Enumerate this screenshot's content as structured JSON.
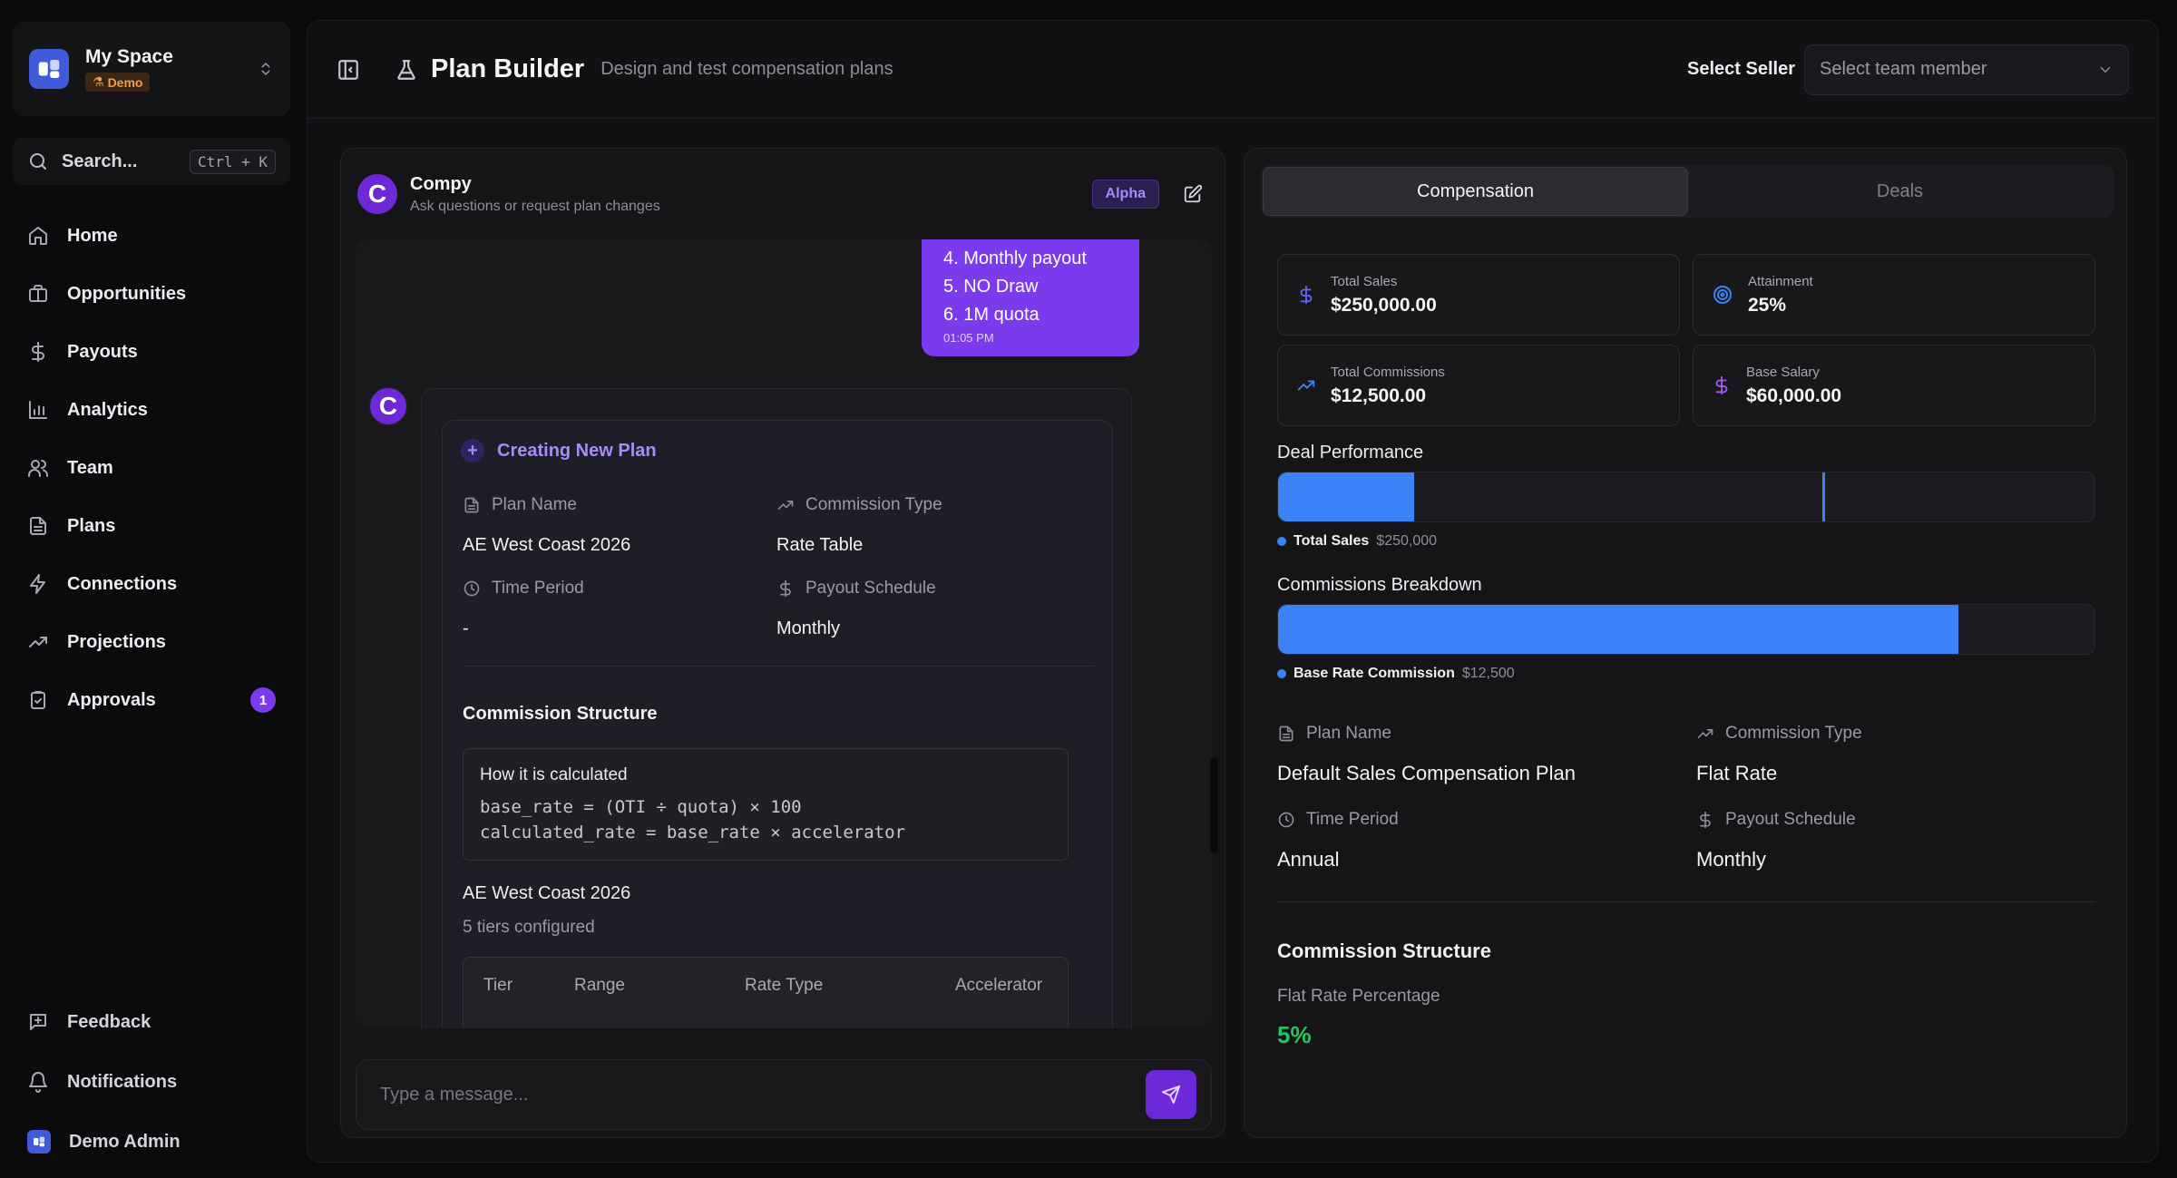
{
  "workspace": {
    "name": "My Space",
    "badge": "Demo"
  },
  "search": {
    "label": "Search...",
    "shortcut": "Ctrl + K"
  },
  "nav": {
    "items": [
      {
        "label": "Home",
        "icon": "home-icon"
      },
      {
        "label": "Opportunities",
        "icon": "briefcase-icon"
      },
      {
        "label": "Payouts",
        "icon": "dollar-icon"
      },
      {
        "label": "Analytics",
        "icon": "bar-chart-icon"
      },
      {
        "label": "Team",
        "icon": "users-icon"
      },
      {
        "label": "Plans",
        "icon": "file-text-icon"
      },
      {
        "label": "Connections",
        "icon": "zap-icon"
      },
      {
        "label": "Projections",
        "icon": "trending-up-icon"
      },
      {
        "label": "Approvals",
        "icon": "clipboard-check-icon",
        "badge": "1"
      }
    ],
    "bottom": [
      {
        "label": "Feedback",
        "icon": "message-plus-icon"
      },
      {
        "label": "Notifications",
        "icon": "bell-icon"
      },
      {
        "label": "Demo Admin",
        "icon": "avatar"
      }
    ]
  },
  "header": {
    "title": "Plan Builder",
    "subtitle": "Design and test compensation plans",
    "seller_label": "Select Seller",
    "seller_placeholder": "Select team member"
  },
  "chat": {
    "bot_name": "Compy",
    "bot_sub": "Ask questions or request plan changes",
    "bot_initial": "C",
    "badge": "Alpha",
    "user_message": {
      "lines": [
        "4. Monthly payout",
        "5. NO Draw",
        "6. 1M quota"
      ],
      "time": "01:05 PM"
    },
    "plan_card": {
      "title": "Creating New Plan",
      "plan_name_label": "Plan Name",
      "plan_name": "AE West Coast 2026",
      "commission_type_label": "Commission Type",
      "commission_type": "Rate Table",
      "time_period_label": "Time Period",
      "time_period": "-",
      "payout_schedule_label": "Payout Schedule",
      "payout_schedule": "Monthly",
      "structure_title": "Commission Structure",
      "formula_title": "How it is calculated",
      "formula_lines": [
        "base_rate = (OTI ÷ quota) × 100",
        "calculated_rate = base_rate × accelerator"
      ],
      "table_name": "AE West Coast 2026",
      "tiers_text": "5 tiers configured",
      "columns": [
        "Tier",
        "Range",
        "Rate Type",
        "Accelerator"
      ]
    },
    "composer_placeholder": "Type a message..."
  },
  "right": {
    "tabs": [
      "Compensation",
      "Deals"
    ],
    "active_tab": 0,
    "stats": [
      {
        "label": "Total Sales",
        "value": "$250,000.00",
        "icon": "dollar-icon",
        "color": "#6366f1"
      },
      {
        "label": "Attainment",
        "value": "25%",
        "icon": "target-icon",
        "color": "#3b82f6"
      },
      {
        "label": "Total Commissions",
        "value": "$12,500.00",
        "icon": "trending-up-icon",
        "color": "#3b82f6"
      },
      {
        "label": "Base Salary",
        "value": "$60,000.00",
        "icon": "dollar-icon",
        "color": "#a855f7"
      }
    ],
    "deal_performance": {
      "title": "Deal Performance",
      "legend_name": "Total Sales",
      "legend_value": "$250,000",
      "fill_fraction": 0.167,
      "marker_fraction": 0.667,
      "color": "#3b82f6"
    },
    "commissions_breakdown": {
      "title": "Commissions Breakdown",
      "legend_name": "Base Rate Commission",
      "legend_value": "$12,500",
      "fill_fraction": 0.833,
      "color": "#3b82f6"
    },
    "plan": {
      "plan_name_label": "Plan Name",
      "plan_name": "Default Sales Compensation Plan",
      "commission_type_label": "Commission Type",
      "commission_type": "Flat Rate",
      "time_period_label": "Time Period",
      "time_period": "Annual",
      "payout_schedule_label": "Payout Schedule",
      "payout_schedule": "Monthly",
      "structure_title": "Commission Structure",
      "flat_rate_label": "Flat Rate Percentage",
      "flat_rate_value": "5%"
    }
  }
}
